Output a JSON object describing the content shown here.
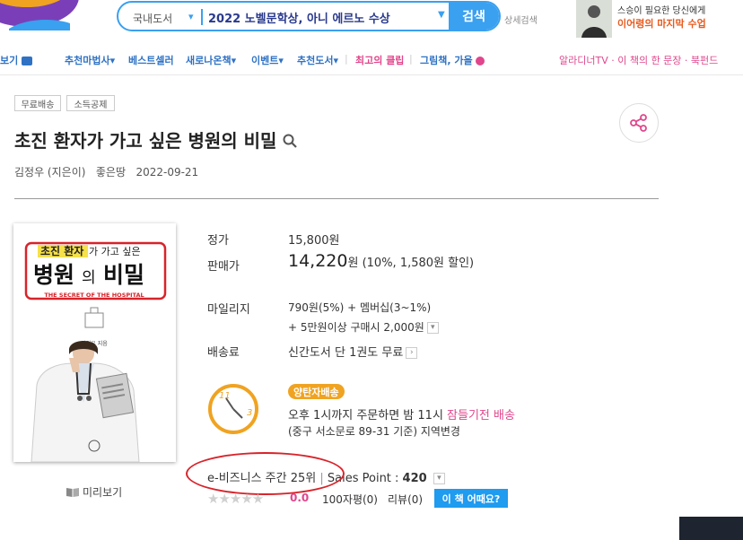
{
  "header": {
    "search": {
      "category": "국내도서",
      "value": "2022 노벨문학상, 아니 에르노 수상",
      "button": "검색"
    },
    "detail_search": "상세검색",
    "ad": {
      "line1": "스승이 필요한 당신에게",
      "line2": "이어령의 마지막 수업"
    }
  },
  "nav": {
    "items": [
      {
        "label": "보기"
      },
      {
        "label": "추천마법사"
      },
      {
        "label": "베스트셀러"
      },
      {
        "label": "새로나온책"
      },
      {
        "label": "이벤트"
      },
      {
        "label": "추천도서"
      },
      {
        "label": "최고의 클립"
      },
      {
        "label": "그림책, 가을"
      }
    ],
    "right": "알라디너TV · 이 책의 한 문장 · 북펀드"
  },
  "book": {
    "badges": [
      "무료배송",
      "소득공제"
    ],
    "title": "초진 환자가 가고 싶은 병원의 비밀",
    "author": "김정우 (지은이)",
    "publisher": "좋은땅",
    "date": "2022-09-21",
    "cover": {
      "line1_hl": "초진 환자",
      "line1_rest": "가 가고 싶은",
      "big1": "병원",
      "small": "의",
      "big2": "비밀",
      "eng": "THE SECRET OF THE HOSPITAL",
      "author": "김정우 지음"
    },
    "preview": "미리보기"
  },
  "price": {
    "list_label": "정가",
    "list_value": "15,800원",
    "sale_label": "판매가",
    "sale_number": "14,220",
    "sale_unit": "원",
    "discount": "(10%, 1,580원 할인)"
  },
  "mileage": {
    "label": "마일리지",
    "line1": "790원(5%) + 멤버십(3~1%)",
    "line2": "+ 5만원이상 구매시 2,000원"
  },
  "shipping": {
    "label": "배송료",
    "value": "신간도서 단 1권도 무료"
  },
  "delivery": {
    "badge": "양탄자배송",
    "clock_11": "11",
    "clock_3": "3",
    "line1_a": "오후 1시까지 주문하면 밤 11시 ",
    "line1_b": "잠들기전 배송",
    "line2_a": "(중구 서소문로 89-31 기준) ",
    "line2_b": "지역변경"
  },
  "sales": {
    "rank": "e-비즈니스 주간 25위",
    "sep": "|",
    "point_label": "Sales Point : ",
    "point_value": "420"
  },
  "reviews": {
    "stars": "★★★★★",
    "rating_value": 0.0,
    "rating_text": "0.0",
    "short": "100자평(0)",
    "review": "리뷰(0)",
    "how_button": "이 책 어때요?"
  },
  "colors": {
    "brand_blue": "#3aa0f0",
    "nav_blue": "#2f72c4",
    "pink": "#e0468c",
    "orange": "#f0a321",
    "annotation_red": "#d8232a"
  }
}
